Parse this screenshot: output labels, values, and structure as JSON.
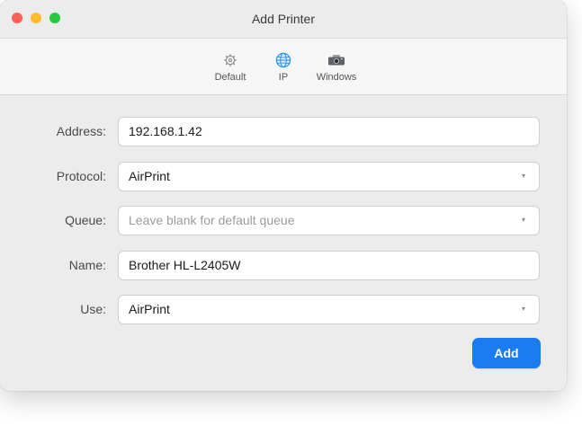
{
  "window": {
    "title": "Add Printer",
    "traffic_lights": {
      "close_color": "#fe5f57",
      "minimize_color": "#febc2e",
      "zoom_color": "#28c840"
    }
  },
  "toolbar": {
    "items": [
      {
        "label": "Default",
        "icon": "gear-icon",
        "selected": false
      },
      {
        "label": "IP",
        "icon": "globe-icon",
        "selected": true
      },
      {
        "label": "Windows",
        "icon": "windows-printer-icon",
        "selected": false
      }
    ]
  },
  "form": {
    "address": {
      "label": "Address:",
      "value": "192.168.1.42"
    },
    "protocol": {
      "label": "Protocol:",
      "value": "AirPrint",
      "caret": "▾"
    },
    "queue": {
      "label": "Queue:",
      "placeholder": "Leave blank for default queue",
      "caret": "▾"
    },
    "name": {
      "label": "Name:",
      "value": "Brother HL-L2405W"
    },
    "use": {
      "label": "Use:",
      "value": "AirPrint",
      "caret": "▾"
    }
  },
  "actions": {
    "add_label": "Add",
    "accent_color": "#1a7cf0"
  }
}
